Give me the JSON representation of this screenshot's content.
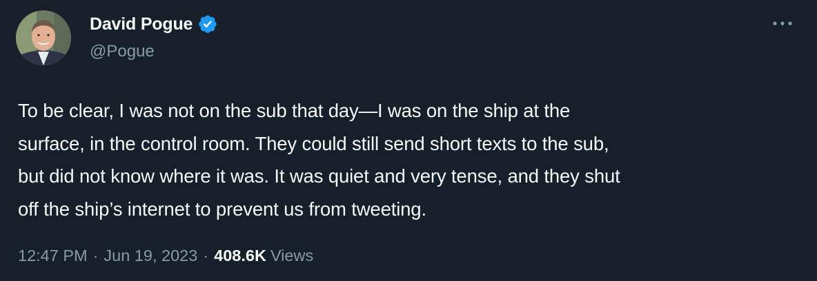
{
  "tweet": {
    "author": {
      "display_name": "David Pogue",
      "handle": "@Pogue",
      "verified": true,
      "avatar_icon": "profile-photo"
    },
    "text": "To be clear, I was not on the sub that day—I was on the ship at the\nsurface, in the control room. They could still send short texts to the sub,\nbut did not know where it was. It was quiet and very tense, and they shut\noff the ship’s internet to prevent us from tweeting.",
    "time": "12:47 PM",
    "separator": "·",
    "date": "Jun 19, 2023",
    "views_count": "408.6K",
    "views_label": "Views"
  },
  "icons": {
    "verified": "verified-badge-icon",
    "more": "more-options-icon"
  },
  "colors": {
    "background": "#15202b",
    "primary_text": "#f7f9f9",
    "secondary_text": "#8b98a5",
    "verified_blue": "#1d9bf0"
  }
}
